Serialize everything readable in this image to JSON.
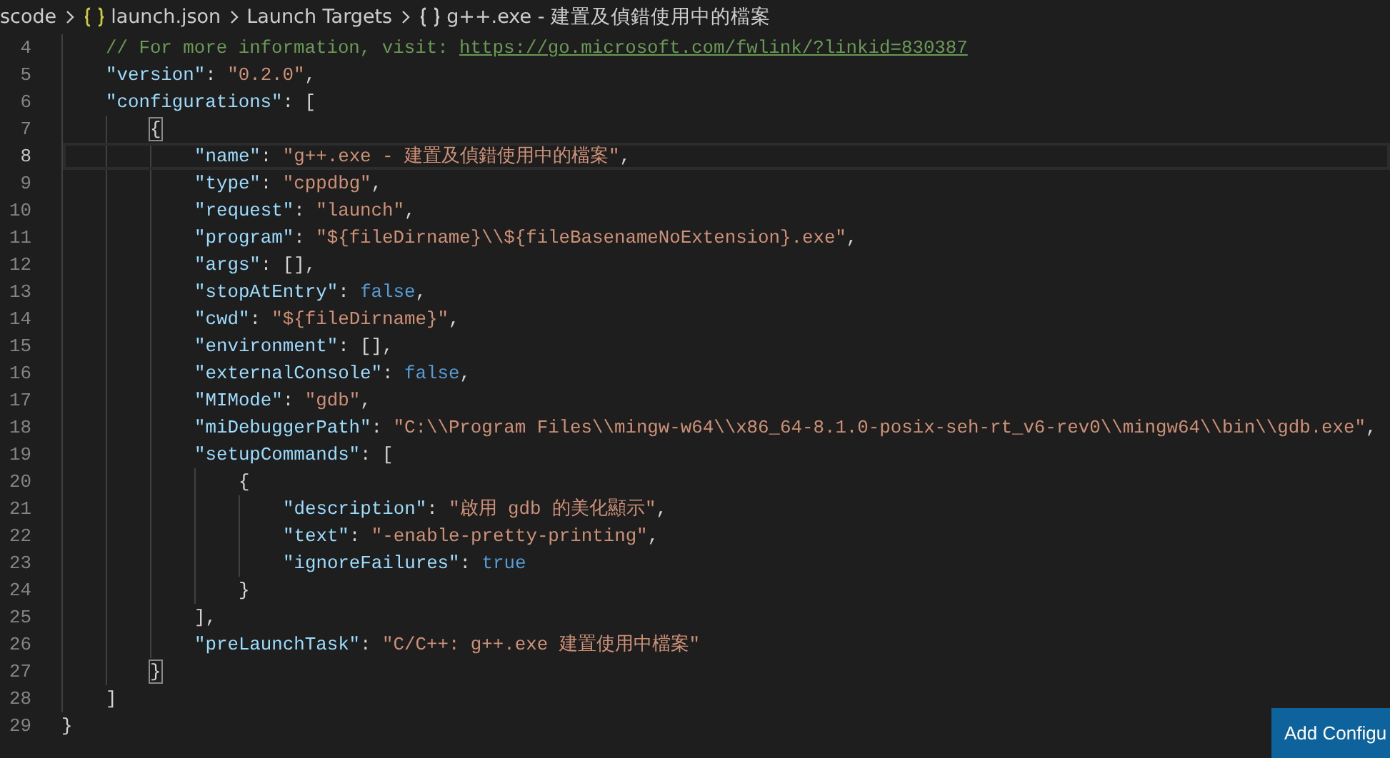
{
  "breadcrumb": [
    {
      "label": "scode",
      "kind": "folder"
    },
    {
      "label": "launch.json",
      "kind": "file"
    },
    {
      "label": "Launch Targets",
      "kind": "folder"
    },
    {
      "label": "g++.exe - 建置及偵錯使用中的檔案",
      "kind": "object"
    }
  ],
  "editor": {
    "lines": [
      {
        "children": [
          {
            "number": "4",
            "current": false,
            "tokens": [
              {
                "kind": "comment",
                "text": "// For more information, visit: "
              },
              {
                "kind": "link",
                "text": "https://go.microsoft.com/fwlink/?linkid=830387"
              }
            ]
          },
          {
            "number": "5",
            "current": false,
            "tokens": [
              {
                "kind": "key",
                "text": "\"version\""
              },
              {
                "kind": "punct",
                "text": ": "
              },
              {
                "kind": "string",
                "text": "\"0.2.0\""
              },
              {
                "kind": "punct",
                "text": ","
              }
            ]
          },
          {
            "number": "6",
            "current": false,
            "tokens": [
              {
                "kind": "key",
                "text": "\"configurations\""
              },
              {
                "kind": "punct",
                "text": ": ["
              }
            ],
            "children": [
              {
                "number": "7",
                "current": false,
                "tokens": [
                  {
                    "kind": "bracket_match",
                    "text": "{"
                  }
                ],
                "children": [
                  {
                    "number": "8",
                    "current": true,
                    "tokens": [
                      {
                        "kind": "key",
                        "text": "\"name\""
                      },
                      {
                        "kind": "punct",
                        "text": ": "
                      },
                      {
                        "kind": "string",
                        "text": "\"g++.exe - 建置及偵錯使用中的檔案\""
                      },
                      {
                        "kind": "punct",
                        "text": ","
                      }
                    ]
                  },
                  {
                    "number": "9",
                    "current": false,
                    "tokens": [
                      {
                        "kind": "key",
                        "text": "\"type\""
                      },
                      {
                        "kind": "punct",
                        "text": ": "
                      },
                      {
                        "kind": "string",
                        "text": "\"cppdbg\""
                      },
                      {
                        "kind": "punct",
                        "text": ","
                      }
                    ]
                  },
                  {
                    "number": "10",
                    "current": false,
                    "tokens": [
                      {
                        "kind": "key",
                        "text": "\"request\""
                      },
                      {
                        "kind": "punct",
                        "text": ": "
                      },
                      {
                        "kind": "string",
                        "text": "\"launch\""
                      },
                      {
                        "kind": "punct",
                        "text": ","
                      }
                    ]
                  },
                  {
                    "number": "11",
                    "current": false,
                    "tokens": [
                      {
                        "kind": "key",
                        "text": "\"program\""
                      },
                      {
                        "kind": "punct",
                        "text": ": "
                      },
                      {
                        "kind": "string",
                        "text": "\"${fileDirname}\\\\${fileBasenameNoExtension}.exe\""
                      },
                      {
                        "kind": "punct",
                        "text": ","
                      }
                    ]
                  },
                  {
                    "number": "12",
                    "current": false,
                    "tokens": [
                      {
                        "kind": "key",
                        "text": "\"args\""
                      },
                      {
                        "kind": "punct",
                        "text": ": [],"
                      }
                    ]
                  },
                  {
                    "number": "13",
                    "current": false,
                    "tokens": [
                      {
                        "kind": "key",
                        "text": "\"stopAtEntry\""
                      },
                      {
                        "kind": "punct",
                        "text": ": "
                      },
                      {
                        "kind": "keyword",
                        "text": "false"
                      },
                      {
                        "kind": "punct",
                        "text": ","
                      }
                    ]
                  },
                  {
                    "number": "14",
                    "current": false,
                    "tokens": [
                      {
                        "kind": "key",
                        "text": "\"cwd\""
                      },
                      {
                        "kind": "punct",
                        "text": ": "
                      },
                      {
                        "kind": "string",
                        "text": "\"${fileDirname}\""
                      },
                      {
                        "kind": "punct",
                        "text": ","
                      }
                    ]
                  },
                  {
                    "number": "15",
                    "current": false,
                    "tokens": [
                      {
                        "kind": "key",
                        "text": "\"environment\""
                      },
                      {
                        "kind": "punct",
                        "text": ": [],"
                      }
                    ]
                  },
                  {
                    "number": "16",
                    "current": false,
                    "tokens": [
                      {
                        "kind": "key",
                        "text": "\"externalConsole\""
                      },
                      {
                        "kind": "punct",
                        "text": ": "
                      },
                      {
                        "kind": "keyword",
                        "text": "false"
                      },
                      {
                        "kind": "punct",
                        "text": ","
                      }
                    ]
                  },
                  {
                    "number": "17",
                    "current": false,
                    "tokens": [
                      {
                        "kind": "key",
                        "text": "\"MIMode\""
                      },
                      {
                        "kind": "punct",
                        "text": ": "
                      },
                      {
                        "kind": "string",
                        "text": "\"gdb\""
                      },
                      {
                        "kind": "punct",
                        "text": ","
                      }
                    ]
                  },
                  {
                    "number": "18",
                    "current": false,
                    "tokens": [
                      {
                        "kind": "key",
                        "text": "\"miDebuggerPath\""
                      },
                      {
                        "kind": "punct",
                        "text": ": "
                      },
                      {
                        "kind": "string",
                        "text": "\"C:\\\\Program Files\\\\mingw-w64\\\\x86_64-8.1.0-posix-seh-rt_v6-rev0\\\\mingw64\\\\bin\\\\gdb.exe\""
                      },
                      {
                        "kind": "punct",
                        "text": ","
                      }
                    ]
                  },
                  {
                    "number": "19",
                    "current": false,
                    "tokens": [
                      {
                        "kind": "key",
                        "text": "\"setupCommands\""
                      },
                      {
                        "kind": "punct",
                        "text": ": ["
                      }
                    ],
                    "children": [
                      {
                        "number": "20",
                        "current": false,
                        "tokens": [
                          {
                            "kind": "punct",
                            "text": "{"
                          }
                        ],
                        "children": [
                          {
                            "number": "21",
                            "current": false,
                            "tokens": [
                              {
                                "kind": "key",
                                "text": "\"description\""
                              },
                              {
                                "kind": "punct",
                                "text": ": "
                              },
                              {
                                "kind": "string",
                                "text": "\"啟用 gdb 的美化顯示\""
                              },
                              {
                                "kind": "punct",
                                "text": ","
                              }
                            ]
                          },
                          {
                            "number": "22",
                            "current": false,
                            "tokens": [
                              {
                                "kind": "key",
                                "text": "\"text\""
                              },
                              {
                                "kind": "punct",
                                "text": ": "
                              },
                              {
                                "kind": "string",
                                "text": "\"-enable-pretty-printing\""
                              },
                              {
                                "kind": "punct",
                                "text": ","
                              }
                            ]
                          },
                          {
                            "number": "23",
                            "current": false,
                            "tokens": [
                              {
                                "kind": "key",
                                "text": "\"ignoreFailures\""
                              },
                              {
                                "kind": "punct",
                                "text": ": "
                              },
                              {
                                "kind": "keyword",
                                "text": "true"
                              }
                            ]
                          }
                        ]
                      },
                      {
                        "number": "24",
                        "current": false,
                        "tokens": [
                          {
                            "kind": "punct",
                            "text": "}"
                          }
                        ]
                      }
                    ]
                  },
                  {
                    "number": "25",
                    "current": false,
                    "tokens": [
                      {
                        "kind": "punct",
                        "text": "],"
                      }
                    ]
                  },
                  {
                    "number": "26",
                    "current": false,
                    "tokens": [
                      {
                        "kind": "key",
                        "text": "\"preLaunchTask\""
                      },
                      {
                        "kind": "punct",
                        "text": ": "
                      },
                      {
                        "kind": "string",
                        "text": "\"C/C++: g++.exe 建置使用中檔案\""
                      }
                    ]
                  }
                ]
              },
              {
                "number": "27",
                "current": false,
                "tokens": [
                  {
                    "kind": "bracket_match",
                    "text": "}"
                  }
                ]
              }
            ]
          },
          {
            "number": "28",
            "current": false,
            "tokens": [
              {
                "kind": "punct",
                "text": "]"
              }
            ]
          }
        ]
      },
      {
        "number": "29",
        "current": false,
        "tokens": [
          {
            "kind": "punct",
            "text": "}"
          }
        ]
      }
    ]
  },
  "add_configuration_button": {
    "label": "Add Configu"
  }
}
